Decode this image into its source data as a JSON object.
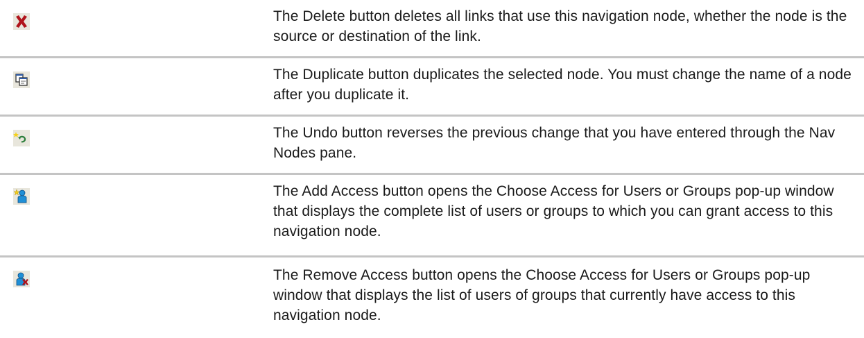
{
  "rows": [
    {
      "icon": "delete-icon",
      "description": "The Delete button deletes all links that use this navigation node, whether the node is the source or destination of the link."
    },
    {
      "icon": "duplicate-icon",
      "description": "The Duplicate button duplicates the selected node. You must change the name of a node after you duplicate it."
    },
    {
      "icon": "undo-icon",
      "description": "The Undo button reverses the previous change that you have entered through the Nav Nodes pane."
    },
    {
      "icon": "add-access-icon",
      "description": "The Add Access button opens the Choose Access for Users or Groups pop-up window that displays the complete list of users or groups to which you can grant access to this navigation node."
    },
    {
      "icon": "remove-access-icon",
      "description": "The Remove Access button opens the Choose Access for Users or Groups pop-up window that displays the list of users of groups that currently have access to this navigation node."
    }
  ],
  "colors": {
    "row_divider": "#c4c4c4",
    "delete_red": "#b0141b",
    "icon_bg": "#e8e6dc",
    "person_blue": "#1f8fd6",
    "star_yellow": "#f4d11c",
    "undo_green": "#2a7d3a"
  }
}
